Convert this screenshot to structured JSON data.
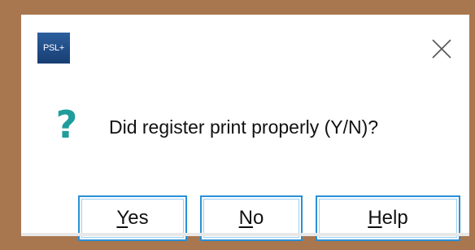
{
  "app": {
    "logo_text": "PSL+"
  },
  "icons": {
    "close": "close-icon",
    "question": "question-icon"
  },
  "colors": {
    "frame": "#a8774f",
    "button_border": "#2a8fd6",
    "question_icon": "#1f9c9c",
    "logo_bg": "#1f4a85"
  },
  "dialog": {
    "question_mark": "?",
    "message": "Did register print properly (Y/N)?",
    "buttons": {
      "yes": {
        "label": "Yes",
        "mnemonic": "Y",
        "rest": "es"
      },
      "no": {
        "label": "No",
        "mnemonic": "N",
        "rest": "o"
      },
      "help": {
        "label": "Help",
        "mnemonic": "H",
        "rest": "elp"
      }
    }
  }
}
